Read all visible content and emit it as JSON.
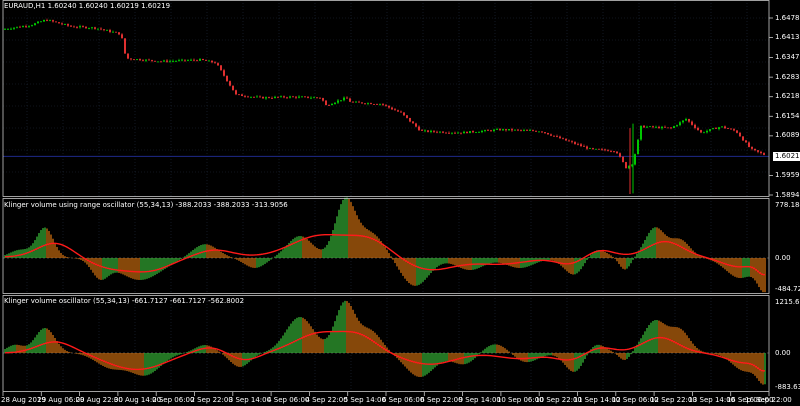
{
  "colors": {
    "background": "#000000",
    "grid": "#1e2a3a",
    "frame": "#c8c8c8",
    "candle_up": "#00c800",
    "candle_down": "#e03030",
    "bid_line": "#1e2a8a",
    "current_price_box": "#ffffff",
    "histo_up": "#3cc43c",
    "histo_down": "#e07810",
    "signal_line": "#ff1a1a",
    "zero_line": "#808080"
  },
  "main": {
    "title": "EURAUD,H1  1.60240 1.60240 1.60219 1.60219",
    "price_ticks": [
      "1.64780",
      "1.64135",
      "1.63475",
      "1.62830",
      "1.62185",
      "1.61540",
      "1.60895",
      "1.59590",
      "1.58945"
    ],
    "price_range": [
      1.58945,
      1.6478
    ],
    "current_price": "1.60219",
    "current_price_value": 1.60219
  },
  "klinger_range": {
    "title": "Klinger volume using range oscillator (55,34,13) -388.2033 -388.2033 -313.9056",
    "ticks": [
      "778.1847",
      "0.00",
      "-484.7285"
    ]
  },
  "klinger": {
    "title": "Klinger volume  oscillator (55,34,13) -661.7127 -661.7127 -562.8002",
    "ticks": [
      "1215.632",
      "0.00",
      "-883.6333"
    ]
  },
  "time_axis": {
    "labels": [
      "28 Aug 2019",
      "29 Aug 06:00",
      "29 Aug 22:00",
      "30 Aug 14:00",
      "2 Sep 06:00",
      "2 Sep 22:00",
      "3 Sep 14:00",
      "4 Sep 06:00",
      "4 Sep 22:00",
      "5 Sep 14:00",
      "6 Sep 06:00",
      "6 Sep 22:00",
      "9 Sep 14:00",
      "10 Sep 06:00",
      "10 Sep 22:00",
      "11 Sep 14:00",
      "12 Sep 06:00",
      "12 Sep 22:00",
      "13 Sep 14:00",
      "16 Sep 06:00",
      "16 Sep 22:00"
    ]
  }
}
